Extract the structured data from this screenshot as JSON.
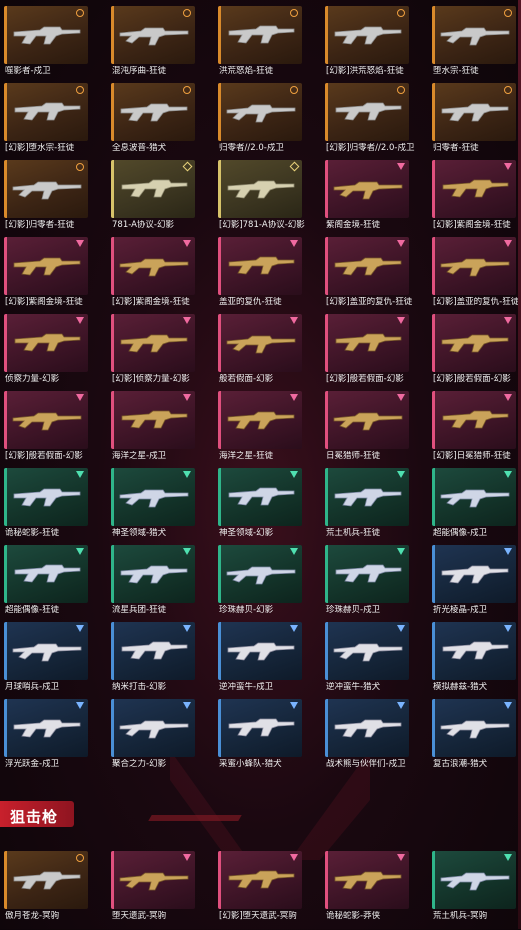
{
  "colors": {
    "background": "#1a0810",
    "section_tag": "#c8202c",
    "tier_gold": "#d98a2b",
    "tier_yellow": "#d7c36a",
    "tier_pink": "#e0507e",
    "tier_teal": "#2fb58a",
    "tier_blue": "#4a8fd6"
  },
  "rifle_grid": [
    {
      "label": "噬影者-戍卫",
      "tier": "gold"
    },
    {
      "label": "混沌序曲-狂徒",
      "tier": "gold"
    },
    {
      "label": "洪荒怒焰-狂徒",
      "tier": "gold"
    },
    {
      "label": "[幻影]洪荒怒焰-狂徒",
      "tier": "gold"
    },
    {
      "label": "堕水宗-狂徒",
      "tier": "gold"
    },
    {
      "label": "[幻影]堕水宗-狂徒",
      "tier": "gold"
    },
    {
      "label": "全息波普-猎犬",
      "tier": "gold"
    },
    {
      "label": "归零者//2.0-戍卫",
      "tier": "gold"
    },
    {
      "label": "[幻影]归零者//2.0-戍卫",
      "tier": "gold"
    },
    {
      "label": "归零者-狂徒",
      "tier": "gold"
    },
    {
      "label": "[幻影]归零者-狂徒",
      "tier": "gold"
    },
    {
      "label": "781-A协议-幻影",
      "tier": "yellow"
    },
    {
      "label": "[幻影]781-A协议-幻影",
      "tier": "yellow"
    },
    {
      "label": "紫阁金境-狂徒",
      "tier": "pink"
    },
    {
      "label": "[幻影]紫阁金境-狂徒",
      "tier": "pink"
    },
    {
      "label": "[幻影]紫阁金境-狂徒",
      "tier": "pink"
    },
    {
      "label": "[幻影]紫阁金境-狂徒",
      "tier": "pink"
    },
    {
      "label": "盖亚的复仇-狂徒",
      "tier": "pink"
    },
    {
      "label": "[幻影]盖亚的复仇-狂徒",
      "tier": "pink"
    },
    {
      "label": "[幻影]盖亚的复仇-狂徒",
      "tier": "pink"
    },
    {
      "label": "侦察力量-幻影",
      "tier": "pink"
    },
    {
      "label": "[幻影]侦察力量-幻影",
      "tier": "pink"
    },
    {
      "label": "般若假面-幻影",
      "tier": "pink"
    },
    {
      "label": "[幻影]般若假面-幻影",
      "tier": "pink"
    },
    {
      "label": "[幻影]般若假面-幻影",
      "tier": "pink"
    },
    {
      "label": "[幻影]般若假面-幻影",
      "tier": "pink"
    },
    {
      "label": "海洋之星-戍卫",
      "tier": "pink"
    },
    {
      "label": "海洋之星-狂徒",
      "tier": "pink"
    },
    {
      "label": "日冕猎师-狂徒",
      "tier": "pink"
    },
    {
      "label": "[幻影]日冕猎师-狂徒",
      "tier": "pink"
    },
    {
      "label": "诡秘蛇影-狂徒",
      "tier": "teal"
    },
    {
      "label": "神圣领域-猎犬",
      "tier": "teal"
    },
    {
      "label": "神圣领域-幻影",
      "tier": "teal"
    },
    {
      "label": "荒土机兵-狂徒",
      "tier": "teal"
    },
    {
      "label": "超能偶像-戍卫",
      "tier": "teal"
    },
    {
      "label": "超能偶像-狂徒",
      "tier": "teal"
    },
    {
      "label": "流星兵团-狂徒",
      "tier": "teal"
    },
    {
      "label": "珍珠赫贝-幻影",
      "tier": "teal"
    },
    {
      "label": "珍珠赫贝-戍卫",
      "tier": "teal"
    },
    {
      "label": "折光棱晶-戍卫",
      "tier": "blue"
    },
    {
      "label": "月球哨兵-戍卫",
      "tier": "blue"
    },
    {
      "label": "纳米打击-幻影",
      "tier": "blue"
    },
    {
      "label": "逆冲蛮牛-戍卫",
      "tier": "blue"
    },
    {
      "label": "逆冲蛮牛-猎犬",
      "tier": "blue"
    },
    {
      "label": "模拟赫兹-猎犬",
      "tier": "blue"
    },
    {
      "label": "浮光跃金-戍卫",
      "tier": "blue"
    },
    {
      "label": "聚合之力-幻影",
      "tier": "blue"
    },
    {
      "label": "采蜜小蜂队-猎犬",
      "tier": "blue"
    },
    {
      "label": "战术熊与伙伴们-戍卫",
      "tier": "blue"
    },
    {
      "label": "复古浪潮-猎犬",
      "tier": "blue"
    }
  ],
  "section": {
    "title": "狙击枪"
  },
  "sniper_grid": [
    {
      "label": "傲月苍龙-冥驹",
      "tier": "gold"
    },
    {
      "label": "堕天遗武-冥驹",
      "tier": "pink"
    },
    {
      "label": "[幻影]堕天遗武-冥驹",
      "tier": "pink"
    },
    {
      "label": "诡秘蛇影-莽侠",
      "tier": "pink"
    },
    {
      "label": "荒土机兵-冥驹",
      "tier": "teal"
    }
  ]
}
